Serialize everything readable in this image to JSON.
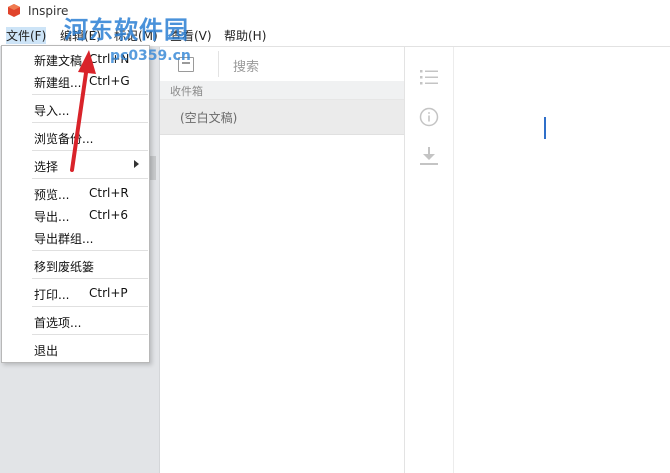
{
  "app": {
    "title": "Inspire"
  },
  "watermark": {
    "text": "河东软件园",
    "url": "pc0359.cn"
  },
  "menubar": {
    "items": [
      {
        "label": "文件(F)"
      },
      {
        "label": "编辑(E)"
      },
      {
        "label": "标记(M)"
      },
      {
        "label": "查看(V)"
      },
      {
        "label": "帮助(H)"
      }
    ]
  },
  "toolbar": {
    "search_label": "搜索"
  },
  "list": {
    "section_title": "收件箱",
    "items": [
      {
        "label": "(空白文稿)"
      }
    ]
  },
  "file_menu": {
    "items": [
      {
        "label": "新建文稿",
        "shortcut": "Ctrl+N"
      },
      {
        "label": "新建组...",
        "shortcut": "Ctrl+G"
      },
      {
        "label": "导入..."
      },
      {
        "label": "浏览备份..."
      },
      {
        "label": "选择"
      },
      {
        "label": "预览...",
        "shortcut": "Ctrl+R"
      },
      {
        "label": "导出...",
        "shortcut": "Ctrl+6"
      },
      {
        "label": "导出群组..."
      },
      {
        "label": "移到废纸篓"
      },
      {
        "label": "打印...",
        "shortcut": "Ctrl+P"
      },
      {
        "label": "首选项..."
      },
      {
        "label": "退出"
      }
    ]
  },
  "colors": {
    "accent": "#2f6fc9",
    "annotation_arrow": "#d9232a",
    "watermark": "#2b7fd4"
  },
  "icons": [
    "app-logo-icon",
    "compose-icon",
    "list-icon",
    "info-icon",
    "download-icon",
    "submenu-arrow-icon"
  ]
}
